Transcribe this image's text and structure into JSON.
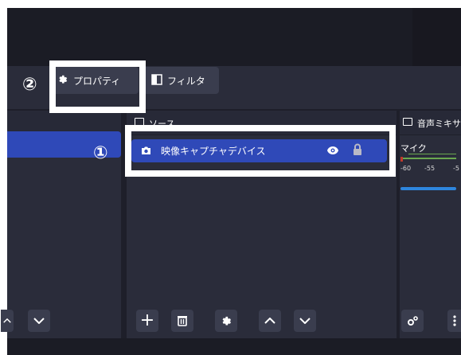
{
  "toolbar": {
    "properties_label": "プロパティ",
    "filters_label": "フィルタ"
  },
  "annotations": {
    "step2": "②",
    "step1": "①"
  },
  "panels": {
    "sources_title": "ソース",
    "mixer_title": "音声ミキサ"
  },
  "sources": [
    {
      "name": "映像キャプチャデバイス",
      "icon": "camera-icon",
      "visible": true,
      "locked": true
    }
  ],
  "mixer": {
    "channel_label": "マイク",
    "ticks": [
      "-60",
      "-55",
      "-5"
    ]
  },
  "buttons": {
    "add": "+",
    "move_up": "^",
    "move_down": "v"
  },
  "colors": {
    "selection_blue": "#2f49b8",
    "panel_bg": "#2a2c3a",
    "highlight_box": "#ffffff"
  }
}
